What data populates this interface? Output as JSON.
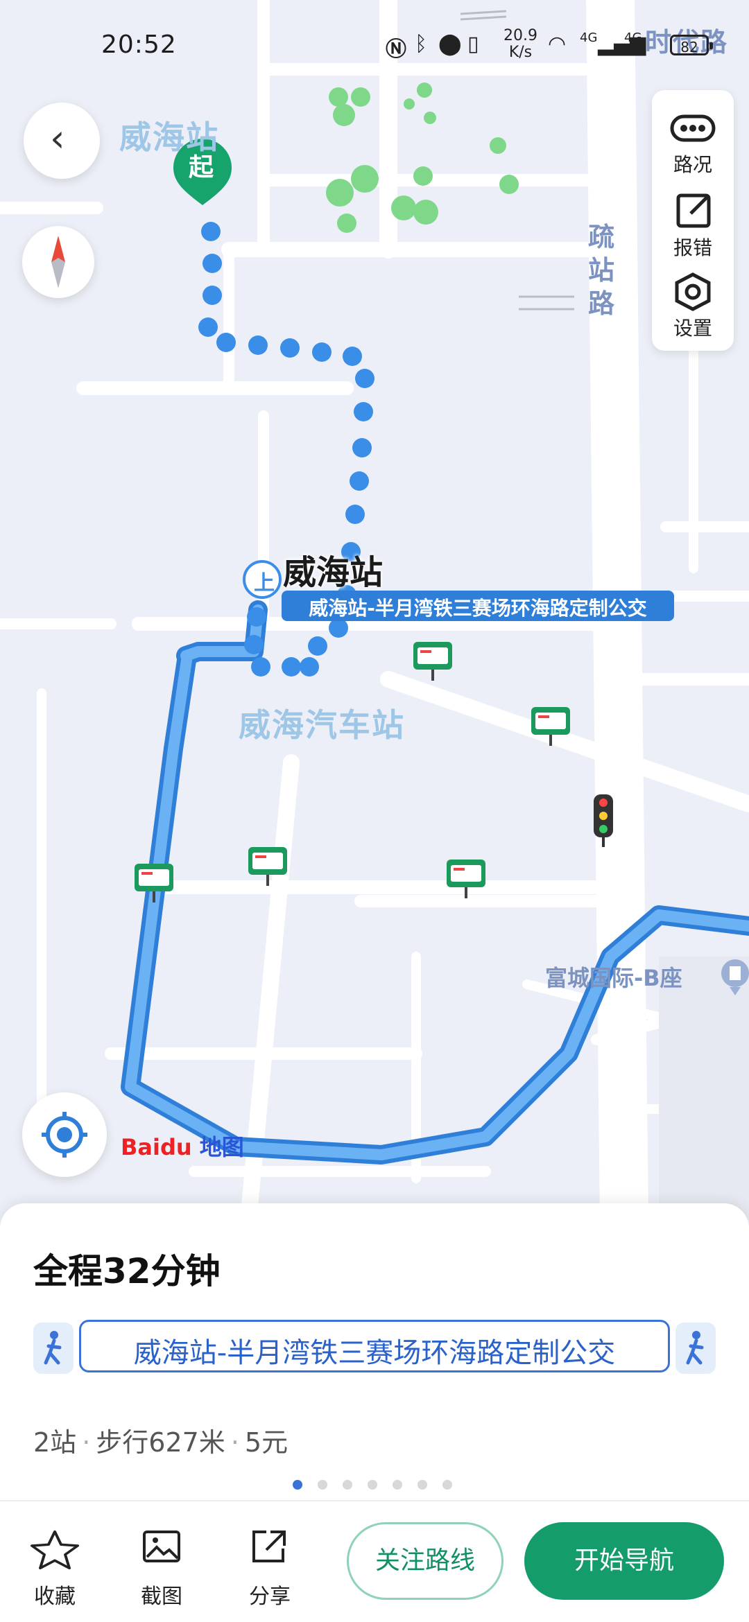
{
  "status_bar": {
    "time": "20:52",
    "speed": "20.9",
    "speed_unit": "K/s",
    "net_left": "4G",
    "net_right": "4G",
    "battery": "82"
  },
  "map": {
    "labels": {
      "weihai_station_faint": "威海站",
      "start_marker": "起",
      "shuzhan_road": "疏站路",
      "shidai_road": "时代路",
      "weihai_station": "威海站",
      "board_marker": "上",
      "route_tag": "威海站-半月湾铁三赛场环海路定制公交",
      "bus_station": "威海汽车站",
      "poi_fucheng": "富城国际-B座",
      "baidu_logo": "Baidu",
      "baidu_map_cn": "地图"
    },
    "controls": {
      "traffic": "路况",
      "report": "报错",
      "settings": "设置"
    }
  },
  "sheet": {
    "total_time": "全程32分钟",
    "route_name": "威海站-半月湾铁三赛场环海路定制公交",
    "stops": "2站",
    "walk": "步行627米",
    "price": "5元",
    "page_count": 7,
    "page_active": 0
  },
  "toolbar": {
    "favorite": "收藏",
    "screenshot": "截图",
    "share": "分享",
    "follow": "关注路线",
    "start_nav": "开始导航"
  },
  "colors": {
    "route_blue": "#3a8ee8",
    "green_accent": "#149c6b",
    "map_bg": "#eceff7"
  }
}
